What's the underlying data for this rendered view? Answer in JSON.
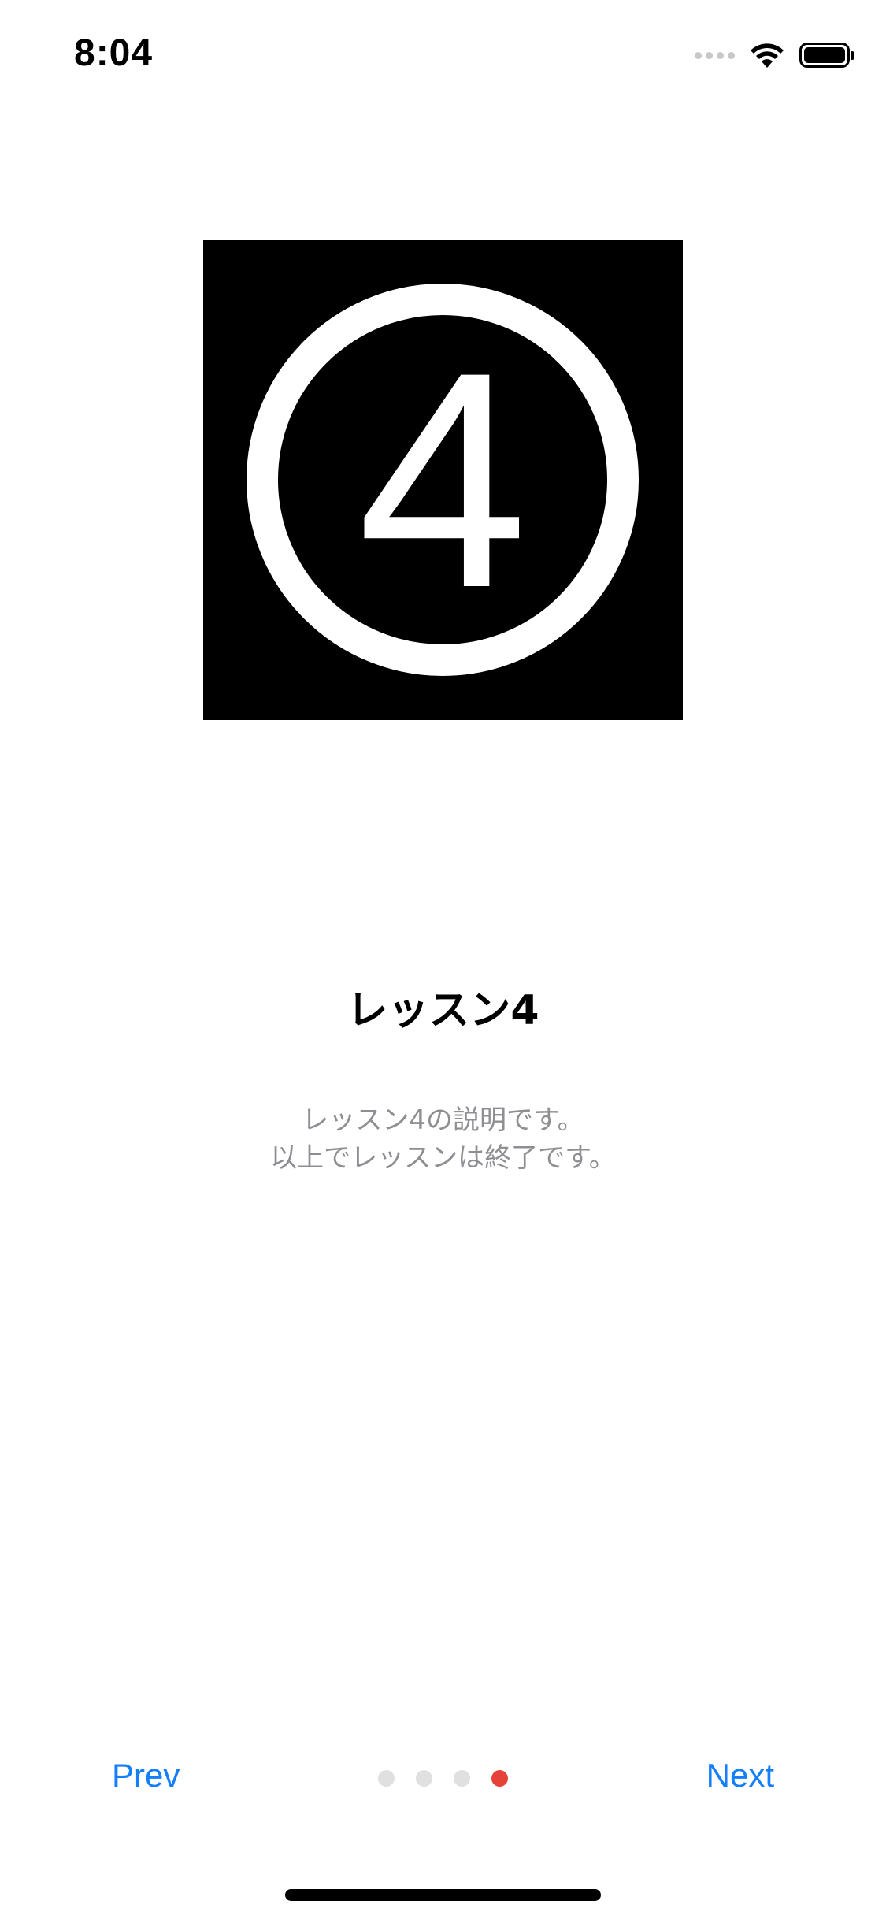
{
  "status_bar": {
    "time": "8:04",
    "icons": [
      "signal-dots-icon",
      "wifi-icon",
      "battery-icon"
    ]
  },
  "lesson": {
    "image": {
      "icon": "circled-number-icon",
      "number": "4"
    },
    "title": "レッスン4",
    "description_lines": [
      "レッスン4の説明です。",
      "以上でレッスンは終了です。"
    ]
  },
  "navigation": {
    "prev_label": "Prev",
    "next_label": "Next"
  },
  "pager": {
    "page_count": 4,
    "current_page": 4
  },
  "colors": {
    "accent": "#147efb",
    "active_dot": "#e5423a",
    "inactive_dot": "#e0e0e0",
    "description_text": "#8e8e93"
  }
}
